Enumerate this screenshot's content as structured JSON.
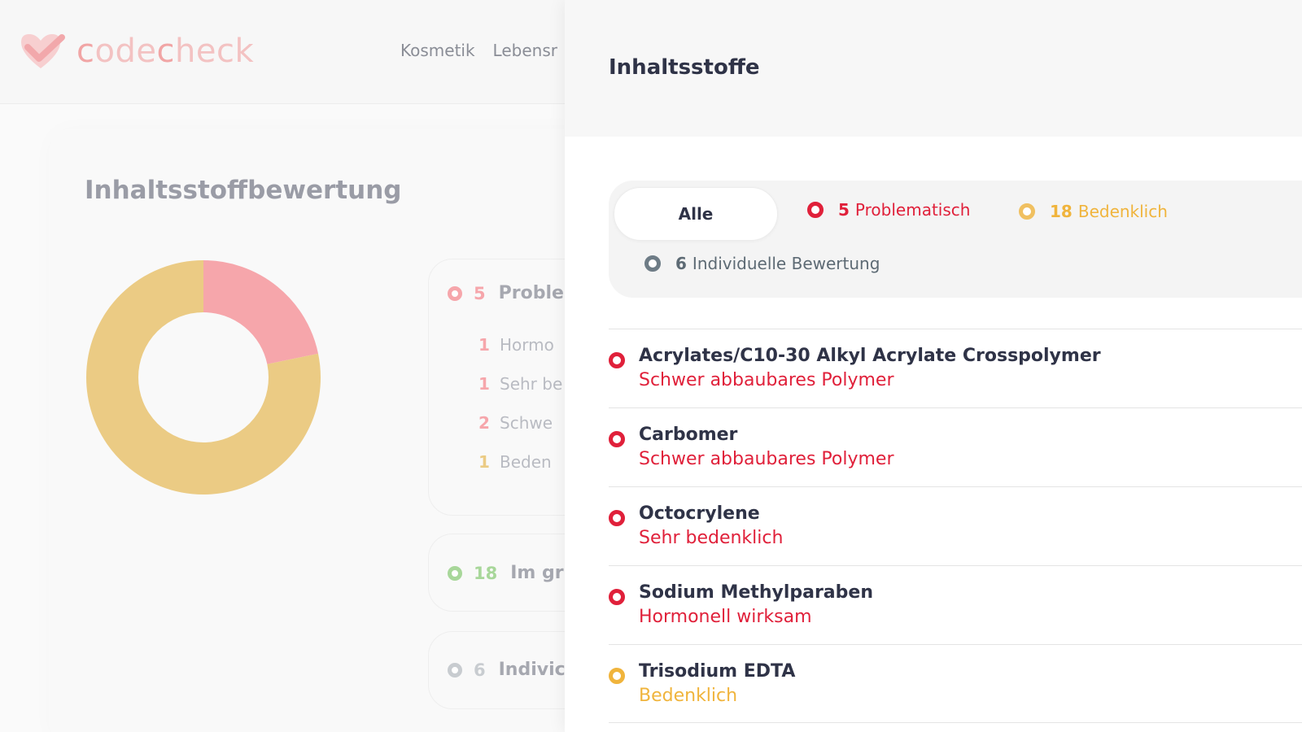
{
  "colors": {
    "problematic": "#e0203a",
    "concerning": "#f0b43c",
    "individual": "#6e7c86",
    "good": "#a8d79a",
    "donut_red": "#f6a6ab",
    "donut_yellow": "#ebcb84"
  },
  "background": {
    "logo": "codecheck",
    "nav": [
      "Kosmetik",
      "Lebensr"
    ],
    "section_title": "Inhaltsstoffbewertung",
    "donut": {
      "type": "pie",
      "segments": [
        {
          "label": "Problematisch",
          "value": 5
        },
        {
          "label": "Bedenklich",
          "value": 18
        }
      ]
    },
    "problematic_card": {
      "count": "5",
      "label": "Proble",
      "items": [
        {
          "count": "1",
          "label": "Hormo"
        },
        {
          "count": "1",
          "label": "Sehr be"
        },
        {
          "count": "2",
          "label": "Schwe"
        },
        {
          "count": "1",
          "label": "Beden"
        }
      ]
    },
    "good_card": {
      "count": "18",
      "label": "Im gr"
    },
    "individual_card": {
      "count": "6",
      "label": "Indivic"
    }
  },
  "panel": {
    "title": "Inhaltsstoffe",
    "filters": {
      "all": "Alle",
      "problematic": {
        "count": "5",
        "label": "Problematisch"
      },
      "concerning": {
        "count": "18",
        "label": "Bedenklich"
      },
      "individual": {
        "count": "6",
        "label": "Individuelle Bewertung"
      }
    },
    "ingredients": [
      {
        "name": "Acrylates/C10-30 Alkyl Acrylate Crosspolymer",
        "rating": "Schwer abbaubares Polymer",
        "level": "problematic"
      },
      {
        "name": "Carbomer",
        "rating": "Schwer abbaubares Polymer",
        "level": "problematic"
      },
      {
        "name": "Octocrylene",
        "rating": "Sehr bedenklich",
        "level": "problematic"
      },
      {
        "name": "Sodium Methylparaben",
        "rating": "Hormonell wirksam",
        "level": "problematic"
      },
      {
        "name": "Trisodium EDTA",
        "rating": "Bedenklich",
        "level": "concerning"
      }
    ]
  }
}
